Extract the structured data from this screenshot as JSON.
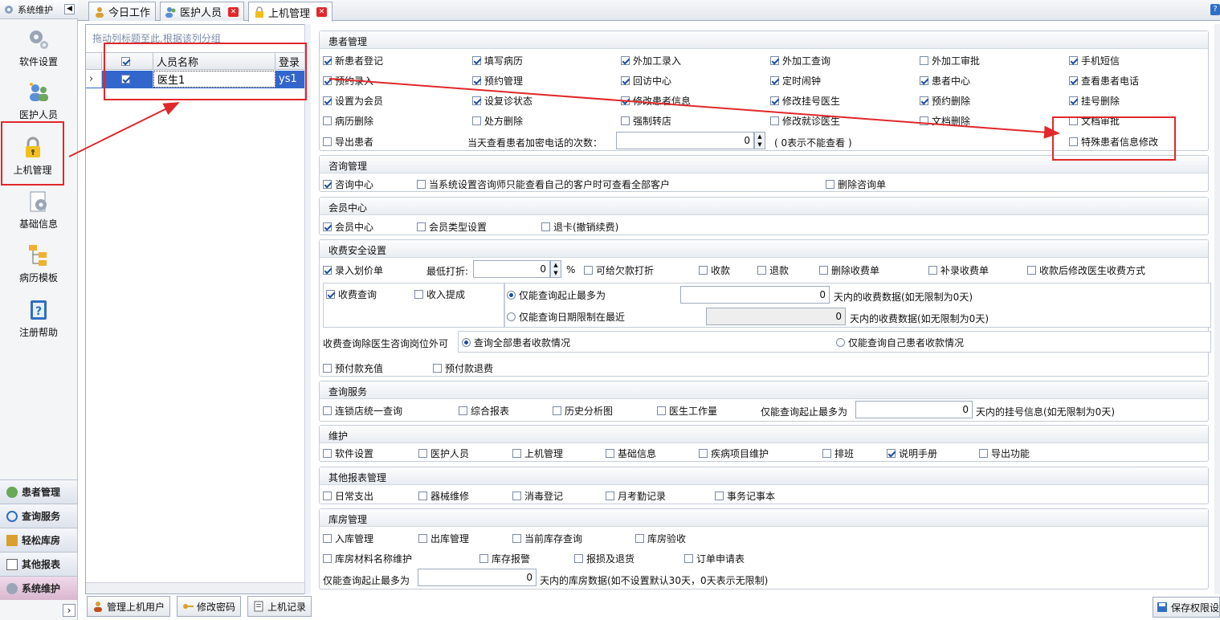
{
  "sidebar": {
    "header": "系统维护",
    "collapse_icon": "◀",
    "items": [
      {
        "label": "软件设置",
        "icon": "gear-icon"
      },
      {
        "label": "医护人员",
        "icon": "users-icon"
      },
      {
        "label": "上机管理",
        "icon": "lock-icon"
      },
      {
        "label": "基础信息",
        "icon": "settings-doc-icon"
      },
      {
        "label": "病历模板",
        "icon": "tree-icon"
      },
      {
        "label": "注册帮助",
        "icon": "help-icon"
      }
    ],
    "bottom_nav": [
      {
        "label": "患者管理"
      },
      {
        "label": "查询服务"
      },
      {
        "label": "轻松库房"
      },
      {
        "label": "其他报表"
      },
      {
        "label": "系统维护"
      }
    ],
    "expand_icon": "›"
  },
  "tabs": [
    {
      "label": "今日工作"
    },
    {
      "label": "医护人员"
    },
    {
      "label": "上机管理"
    }
  ],
  "grid": {
    "group_hint": "拖动列标题至此,根据该列分组",
    "headers": [
      "人员名称",
      "登录"
    ],
    "rows": [
      {
        "name": "医生1",
        "login": "ys1"
      }
    ],
    "row_indicator": "›"
  },
  "toolbar": {
    "manage_users": "管理上机用户",
    "change_password": "修改密码",
    "login_records": "上机记录",
    "save": "保存权限设"
  },
  "patient_mgmt": {
    "title": "患者管理",
    "items": [
      {
        "label": "新患者登记",
        "on": true
      },
      {
        "label": "填写病历",
        "on": true
      },
      {
        "label": "外加工录入",
        "on": true
      },
      {
        "label": "外加工查询",
        "on": true
      },
      {
        "label": "外加工审批",
        "on": false
      },
      {
        "label": "手机短信",
        "on": true
      },
      {
        "label": "预约录入",
        "on": true
      },
      {
        "label": "预约管理",
        "on": true
      },
      {
        "label": "回访中心",
        "on": true
      },
      {
        "label": "定时闹钟",
        "on": true
      },
      {
        "label": "患者中心",
        "on": true
      },
      {
        "label": "查看患者电话",
        "on": true
      },
      {
        "label": "设置为会员",
        "on": true
      },
      {
        "label": "设复诊状态",
        "on": true
      },
      {
        "label": "修改患者信息",
        "on": true
      },
      {
        "label": "修改挂号医生",
        "on": true
      },
      {
        "label": "预约删除",
        "on": true
      },
      {
        "label": "挂号删除",
        "on": true
      },
      {
        "label": "病历删除",
        "on": false
      },
      {
        "label": "处方删除",
        "on": false
      },
      {
        "label": "强制转店",
        "on": false
      },
      {
        "label": "修改就诊医生",
        "on": false
      },
      {
        "label": "文档删除",
        "on": false
      },
      {
        "label": "文档审批",
        "on": false
      }
    ],
    "export_label": "导出患者",
    "phone_view_label": "当天查看患者加密电话的次数：",
    "phone_view_value": "0",
    "phone_view_hint": "( 0表示不能查看 )",
    "special_label": "特殊患者信息修改"
  },
  "consult_mgmt": {
    "title": "咨询管理",
    "items": [
      {
        "label": "咨询中心",
        "on": true
      },
      {
        "label": "当系统设置咨询师只能查看自己的客户时可查看全部客户",
        "on": false
      },
      {
        "label": "删除咨询单",
        "on": false
      }
    ]
  },
  "member_center": {
    "title": "会员中心",
    "items": [
      {
        "label": "会员中心",
        "on": true
      },
      {
        "label": "会员类型设置",
        "on": false
      },
      {
        "label": "退卡(撤销续费)",
        "on": false
      }
    ]
  },
  "fee_security": {
    "title": "收费安全设置",
    "entry_price": "录入划价单",
    "min_discount_label": "最低打折:",
    "min_discount_value": "0",
    "percent": "%",
    "row1": [
      {
        "label": "可给欠款打折",
        "on": false
      },
      {
        "label": "收款",
        "on": false
      },
      {
        "label": "退款",
        "on": false
      },
      {
        "label": "删除收费单",
        "on": false
      },
      {
        "label": "补录收费单",
        "on": false
      },
      {
        "label": "收款后修改医生收费方式",
        "on": false
      }
    ],
    "fee_query": "收费查询",
    "income_commission": "收入提成",
    "radio_max_days": "仅能查询起止最多为",
    "max_days_value": "0",
    "max_days_suffix": "天内的收费数据(如无限制为0天)",
    "radio_recent": "仅能查询日期限制在最近",
    "recent_value": "0",
    "recent_suffix": "天内的收费数据(如无限制为0天)",
    "doctor_scope_label": "收费查询除医生咨询岗位外可",
    "scope_all": "查询全部患者收款情况",
    "scope_own": "仅能查询自己患者收款情况",
    "prepay_recharge": "预付款充值",
    "prepay_refund": "预付款退费"
  },
  "query_service": {
    "title": "查询服务",
    "items": [
      {
        "label": "连锁店统一查询",
        "on": false
      },
      {
        "label": "综合报表",
        "on": false
      },
      {
        "label": "历史分析图",
        "on": false
      },
      {
        "label": "医生工作量",
        "on": false
      }
    ],
    "max_label": "仅能查询起止最多为",
    "max_value": "0",
    "max_suffix": "天内的挂号信息(如无限制为0天)"
  },
  "maintenance": {
    "title": "维护",
    "items": [
      {
        "label": "软件设置",
        "on": false
      },
      {
        "label": "医护人员",
        "on": false
      },
      {
        "label": "上机管理",
        "on": false
      },
      {
        "label": "基础信息",
        "on": false
      },
      {
        "label": "疾病项目维护",
        "on": false
      },
      {
        "label": "排班",
        "on": false
      },
      {
        "label": "说明手册",
        "on": true
      },
      {
        "label": "导出功能",
        "on": false
      }
    ]
  },
  "other_reports": {
    "title": "其他报表管理",
    "items": [
      {
        "label": "日常支出",
        "on": false
      },
      {
        "label": "器械维修",
        "on": false
      },
      {
        "label": "消毒登记",
        "on": false
      },
      {
        "label": "月考勤记录",
        "on": false
      },
      {
        "label": "事务记事本",
        "on": false
      }
    ]
  },
  "warehouse": {
    "title": "库房管理",
    "row1": [
      {
        "label": "入库管理",
        "on": false
      },
      {
        "label": "出库管理",
        "on": false
      },
      {
        "label": "当前库存查询",
        "on": false
      },
      {
        "label": "库房验收",
        "on": false
      }
    ],
    "row2": [
      {
        "label": "库房材料名称维护",
        "on": false
      },
      {
        "label": "库存报警",
        "on": false
      },
      {
        "label": "报损及退货",
        "on": false
      },
      {
        "label": "订单申请表",
        "on": false
      }
    ],
    "max_label": "仅能查询起止最多为",
    "max_value": "0",
    "max_suffix": "天内的库房数据(如不设置默认30天，0天表示无限制)"
  },
  "colors": {
    "accent": "#3366cc",
    "annotation_red": "#e0282b"
  }
}
